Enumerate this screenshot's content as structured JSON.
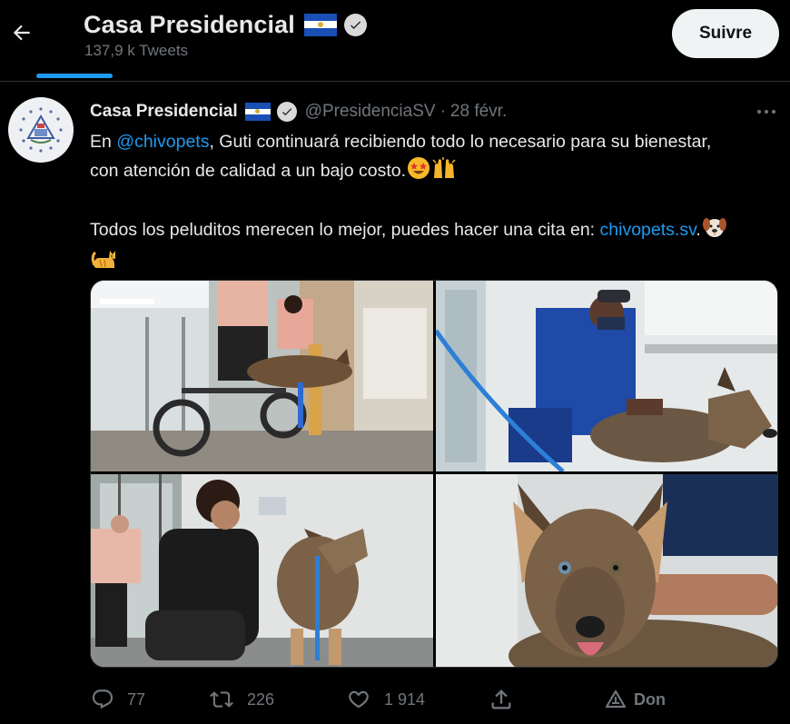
{
  "header": {
    "title": "Casa Presidencial",
    "tweet_count": "137,9 k Tweets",
    "follow_label": "Suivre",
    "back_icon": "arrow-left-icon"
  },
  "tweet": {
    "author_name": "Casa Presidencial",
    "handle": "@PresidenciaSV",
    "separator": "·",
    "date": "28 févr.",
    "text": {
      "line1_prefix": "En ",
      "mention": "@chivopets",
      "line1_rest": ", Guti continuará recibiendo todo lo necesario para su bienestar, con atención de calidad a un bajo costo.",
      "line2": "Todos los peluditos merecen lo mejor, puedes hacer una cita en: ",
      "link": "chivopets.sv",
      "link_suffix": "."
    },
    "emojis": [
      "star-struck-emoji",
      "raising-hands-emoji",
      "dog-face-emoji",
      "cat-emoji"
    ],
    "media": [
      {
        "description_icon": "photo-dog-wheelchair"
      },
      {
        "description_icon": "photo-vet-examining-dog"
      },
      {
        "description_icon": "photo-woman-with-dog"
      },
      {
        "description_icon": "photo-dog-closeup"
      }
    ]
  },
  "actions": {
    "reply_count": "77",
    "retweet_count": "226",
    "like_count": "1 914",
    "donate_label": "Don"
  },
  "colors": {
    "background": "#000000",
    "text": "#e7e9ea",
    "muted": "#71767b",
    "accent": "#1d9bf0",
    "follow_bg": "#eff3f4"
  }
}
